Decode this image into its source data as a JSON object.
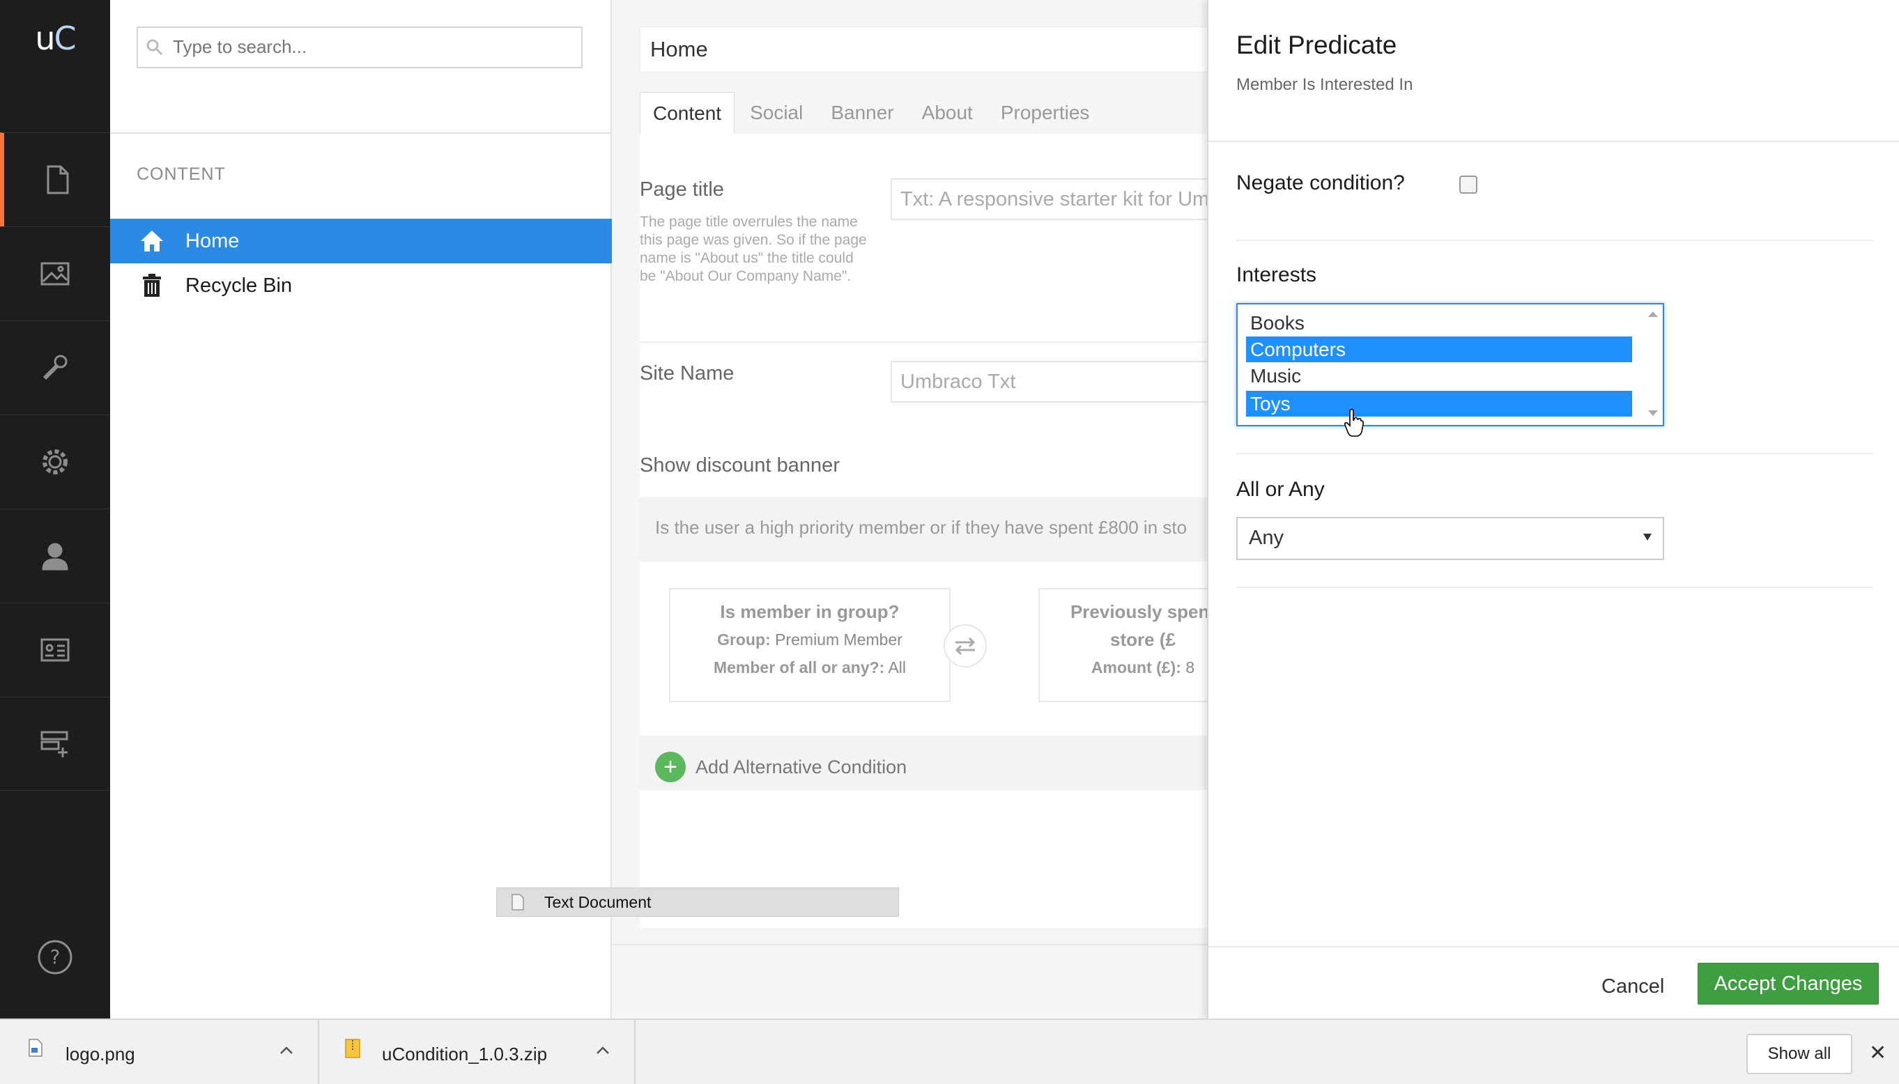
{
  "app": {
    "logo_u": "u",
    "logo_c": "C",
    "nav": [
      {
        "name": "content",
        "icon": "document-icon"
      },
      {
        "name": "media",
        "icon": "image-icon"
      },
      {
        "name": "developer",
        "icon": "wrench-icon"
      },
      {
        "name": "settings",
        "icon": "gear-icon"
      },
      {
        "name": "users",
        "icon": "user-icon"
      },
      {
        "name": "members",
        "icon": "id-card-icon"
      },
      {
        "name": "forms",
        "icon": "form-add-icon"
      }
    ],
    "help_icon": "help-icon"
  },
  "tree": {
    "search_placeholder": "Type to search...",
    "heading": "CONTENT",
    "items": [
      {
        "label": "Home",
        "icon": "home-icon",
        "selected": true
      },
      {
        "label": "Recycle Bin",
        "icon": "trash-icon",
        "selected": false
      }
    ]
  },
  "editor": {
    "page_name": "Home",
    "tabs": [
      "Content",
      "Social",
      "Banner",
      "About",
      "Properties"
    ],
    "active_tab": "Content",
    "page_title": {
      "label": "Page title",
      "description": "The page title overrules the name this page was given. So if the page name is \"About us\" the title could be \"About Our Company Name\".",
      "value": "Txt: A responsive starter kit for Um"
    },
    "site_name": {
      "label": "Site Name",
      "value": "Umbraco Txt"
    },
    "banner": {
      "label": "Show discount banner",
      "description": "Is the user a high priority member or if they have spent £800 in sto",
      "card1": {
        "title": "Is member in group?",
        "line1_key": "Group:",
        "line1_val": "Premium Member",
        "line2_key": "Member of all or any?:",
        "line2_val": "All"
      },
      "card2": {
        "title_line1": "Previously spent",
        "title_line2": "store (£",
        "line1_key": "Amount (£):",
        "line1_val": "8"
      },
      "add_alternative": "Add Alternative Condition"
    }
  },
  "drag_ghost": {
    "label": "Text Document"
  },
  "dialog": {
    "title": "Edit Predicate",
    "subtitle": "Member Is Interested In",
    "negate_label": "Negate condition?",
    "negate_checked": false,
    "interests_label": "Interests",
    "interests": [
      {
        "label": "Books",
        "selected": false
      },
      {
        "label": "Computers",
        "selected": true
      },
      {
        "label": "Music",
        "selected": false
      },
      {
        "label": "Toys",
        "selected": true
      }
    ],
    "all_or_any_label": "All or Any",
    "all_or_any_value": "Any",
    "cancel_label": "Cancel",
    "accept_label": "Accept Changes"
  },
  "downloads": {
    "items": [
      {
        "name": "logo.png",
        "icon": "image-file-icon"
      },
      {
        "name": "uCondition_1.0.3.zip",
        "icon": "zip-file-icon"
      }
    ],
    "show_all": "Show all"
  },
  "colors": {
    "sidebar_bg": "#1d1d1d",
    "active_accent": "#f5753b",
    "selection_blue": "#2b8ae4",
    "accept_green": "#3f9e3f"
  }
}
